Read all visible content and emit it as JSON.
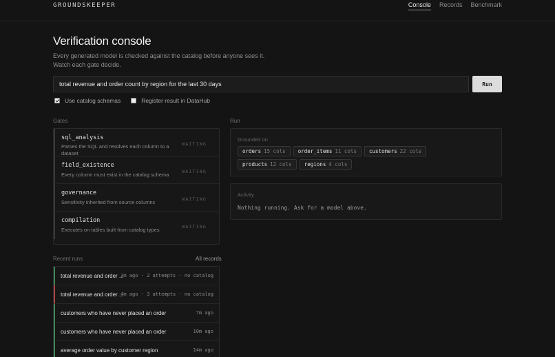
{
  "header": {
    "brand": "GROUNDSKEEPER",
    "nav": [
      {
        "label": "Console",
        "active": true
      },
      {
        "label": "Records",
        "active": false
      },
      {
        "label": "Benchmark",
        "active": false
      }
    ]
  },
  "page": {
    "title": "Verification console",
    "subtitle_line1": "Every generated model is checked against the catalog before anyone sees it.",
    "subtitle_line2": "Watch each gate decide."
  },
  "query": {
    "value": "total revenue and order count by region for the last 30 days",
    "run_label": "Run"
  },
  "options": [
    {
      "label": "Use catalog schemas",
      "checked": true
    },
    {
      "label": "Register result in DataHub",
      "checked": false
    }
  ],
  "gates": {
    "label": "Gates",
    "items": [
      {
        "name": "sql_analysis",
        "desc": "Parses the SQL and resolves each column to a dataset",
        "status": "WAITING"
      },
      {
        "name": "field_existence",
        "desc": "Every column must exist in the catalog schema",
        "status": "WAITING"
      },
      {
        "name": "governance",
        "desc": "Sensitivity inherited from source columns",
        "status": "WAITING"
      },
      {
        "name": "compilation",
        "desc": "Executes on tables built from catalog types",
        "status": "WAITING"
      }
    ]
  },
  "run": {
    "label": "Run",
    "grounded_label": "Grounded on",
    "datasets": [
      {
        "name": "orders",
        "count": "15 cols"
      },
      {
        "name": "order_items",
        "count": "11 cols"
      },
      {
        "name": "customers",
        "count": "22 cols"
      },
      {
        "name": "products",
        "count": "12 cols"
      },
      {
        "name": "regions",
        "count": "4 cols"
      }
    ],
    "activity_label": "Activity",
    "activity_text": "Nothing running. Ask for a model above."
  },
  "recent": {
    "label": "Recent runs",
    "all_records": "All records",
    "items": [
      {
        "query": "total revenue and order ...",
        "meta": "3m ago · 2 attempts · no catalog",
        "status": "pass"
      },
      {
        "query": "total revenue and order ...",
        "meta": "4m ago · 3 attempts · no catalog",
        "status": "fail"
      },
      {
        "query": "customers who have never placed an order",
        "meta": "7m ago",
        "status": "pass"
      },
      {
        "query": "customers who have never placed an order",
        "meta": "10m ago",
        "status": "pass"
      },
      {
        "query": "average order value by customer region",
        "meta": "14m ago",
        "status": "pass"
      }
    ]
  },
  "colors": {
    "pass": "#3f8a52",
    "fail": "#b04545",
    "background": "#141414"
  }
}
